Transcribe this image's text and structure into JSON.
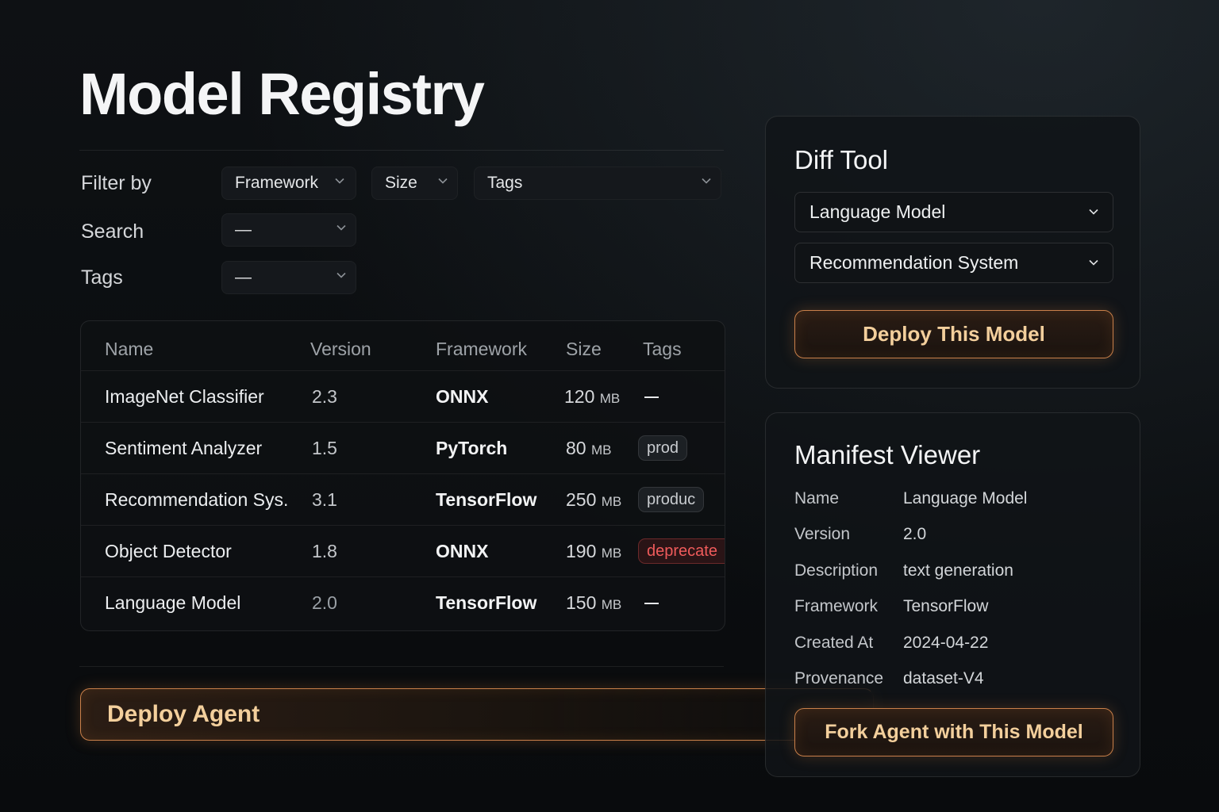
{
  "page": {
    "title": "Model Registry"
  },
  "filters": {
    "filter_by_label": "Filter by",
    "search_label": "Search",
    "tags_label": "Tags",
    "framework_dropdown": "Framework",
    "size_dropdown": "Size",
    "tags_dropdown": "Tags",
    "search_value": "—",
    "tags_value": "—"
  },
  "table": {
    "headers": [
      "Name",
      "Version",
      "Framework",
      "Size",
      "Tags"
    ],
    "rows": [
      {
        "name": "ImageNet Classifier",
        "version": "2.3",
        "framework": "ONNX",
        "size": "120",
        "unit": "MB",
        "tag": "",
        "tag_style": "none"
      },
      {
        "name": "Sentiment Analyzer",
        "version": "1.5",
        "framework": "PyTorch",
        "size": "80",
        "unit": "MB",
        "tag": "prod",
        "tag_style": "neutral"
      },
      {
        "name": "Recommendation Sys.",
        "version": "3.1",
        "framework": "TensorFlow",
        "size": "250",
        "unit": "MB",
        "tag": "produc",
        "tag_style": "neutral"
      },
      {
        "name": "Object Detector",
        "version": "1.8",
        "framework": "ONNX",
        "size": "190",
        "unit": "MB",
        "tag": "deprecate",
        "tag_style": "red"
      },
      {
        "name": "Language Model",
        "version": "2.0",
        "framework": "TensorFlow",
        "size": "150",
        "unit": "MB",
        "tag": "",
        "tag_style": "none"
      }
    ]
  },
  "deploy_agent": {
    "label": "Deploy Agent"
  },
  "diff_tool": {
    "title": "Diff Tool",
    "select_a": "Language Model",
    "select_b": "Recommendation System",
    "deploy_label": "Deploy This Model"
  },
  "manifest": {
    "title": "Manifest Viewer",
    "fields": [
      {
        "key": "Name",
        "value": "Language Model"
      },
      {
        "key": "Version",
        "value": "2.0"
      },
      {
        "key": "Description",
        "value": "text generation"
      },
      {
        "key": "Framework",
        "value": "TensorFlow"
      },
      {
        "key": "Created At",
        "value": "2024-04-22"
      },
      {
        "key": "Provenance",
        "value": "dataset-V4"
      }
    ],
    "fork_label": "Fork Agent with This Model"
  },
  "colors": {
    "accent": "#c9804a",
    "accent_text": "#f3cf9c",
    "danger": "#ef5b5b"
  }
}
